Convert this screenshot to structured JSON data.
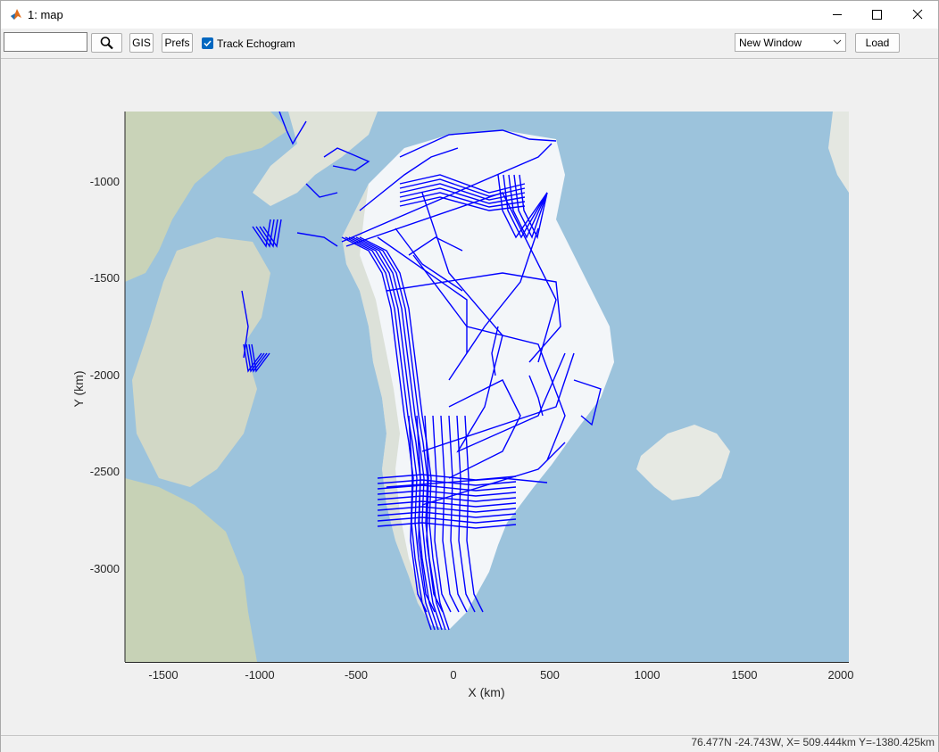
{
  "window": {
    "title": "1: map",
    "minimize_icon": "minimize-icon",
    "maximize_icon": "maximize-icon",
    "close_icon": "close-icon"
  },
  "toolbar": {
    "search_value": "",
    "search_icon": "magnifier-icon",
    "gis_label": "GIS",
    "prefs_label": "Prefs",
    "track_echogram_label": "Track Echogram",
    "track_echogram_checked": true,
    "window_select_value": "New Window",
    "load_label": "Load"
  },
  "plot": {
    "xlabel": "X (km)",
    "ylabel": "Y (km)",
    "xticks": [
      "-1500",
      "-1000",
      "-500",
      "0",
      "500",
      "1000",
      "1500",
      "2000"
    ],
    "yticks": [
      "-1000",
      "-1500",
      "-2000",
      "-2500",
      "-3000"
    ],
    "track_color": "#0000ff",
    "ocean_color": "#9cc3dc",
    "ice_color": "#f3f6f9"
  },
  "statusbar": {
    "coords": "76.477N -24.743W, X= 509.444km Y=-1380.425km"
  }
}
